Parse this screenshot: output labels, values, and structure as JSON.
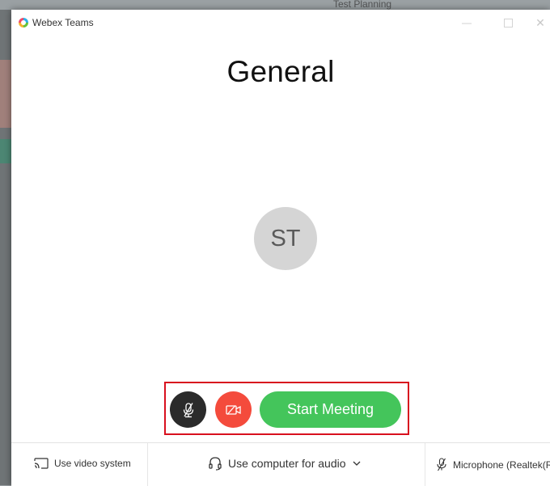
{
  "background": {
    "window_title_partial": "Test Planning"
  },
  "window": {
    "app_title": "Webex Teams",
    "min_glyph": "—",
    "close_glyph": "✕"
  },
  "main": {
    "heading": "General",
    "avatar_initials": "ST"
  },
  "controls": {
    "mic_icon": "mic-muted-icon",
    "camera_icon": "camera-off-icon",
    "start_label": "Start Meeting",
    "colors": {
      "mic_bg": "#2b2b2b",
      "camera_bg": "#f44b3c",
      "start_bg": "#44c55b",
      "highlight": "#d8101e"
    }
  },
  "footer": {
    "video_system_label": "Use video system",
    "audio_label": "Use computer for audio",
    "microphone_label": "Microphone (Realtek(R)..."
  }
}
